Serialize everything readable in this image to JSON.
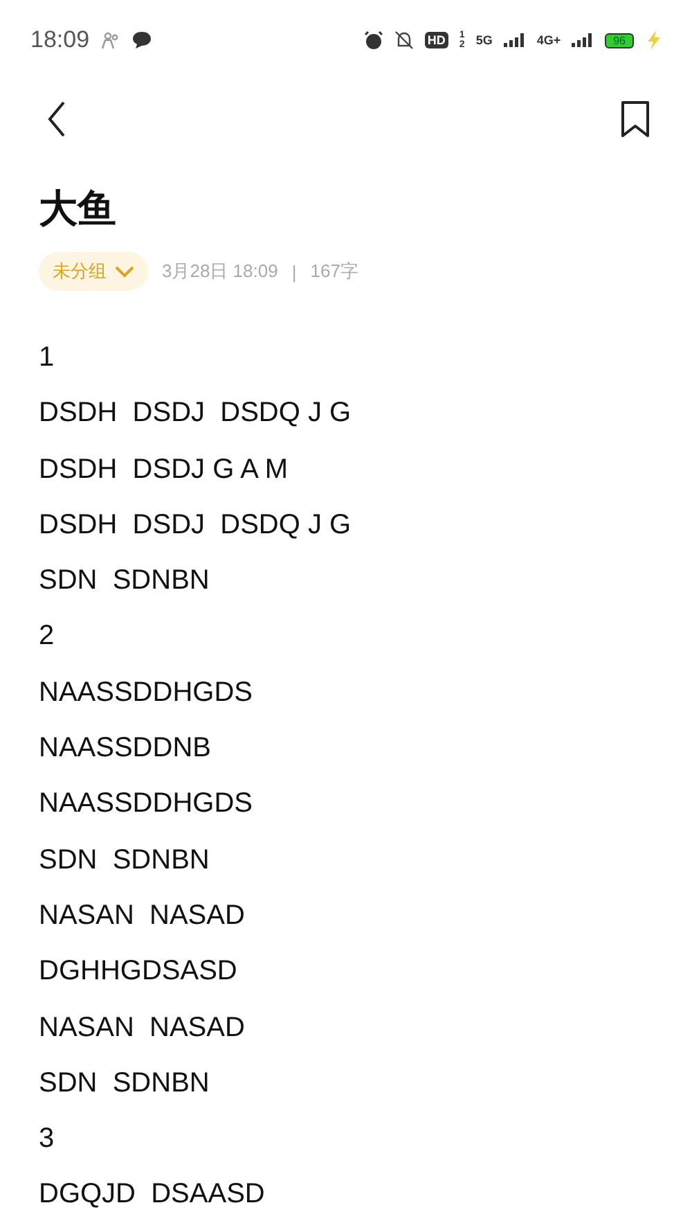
{
  "status_bar": {
    "time": "18:09",
    "hd": "HD",
    "sim_slots": [
      "1",
      "2"
    ],
    "network_1": "5G",
    "network_2": "4G+",
    "battery": "96"
  },
  "note": {
    "title": "大鱼",
    "group": "未分组",
    "date": "3月28日 18:09",
    "separator": "|",
    "count": "167字",
    "lines": [
      "1",
      "DSDH  DSDJ  DSDQ J G",
      "DSDH  DSDJ G A M",
      "DSDH  DSDJ  DSDQ J G",
      "SDN  SDNBN",
      "2",
      "NAASSDDHGDS",
      "NAASSDDNB",
      "NAASSDDHGDS",
      "SDN  SDNBN",
      "NASAN  NASAD",
      "DGHHGDSASD",
      "NASAN  NASAD",
      "SDN  SDNBN",
      "3",
      "DGQJD  DSAASD"
    ]
  }
}
